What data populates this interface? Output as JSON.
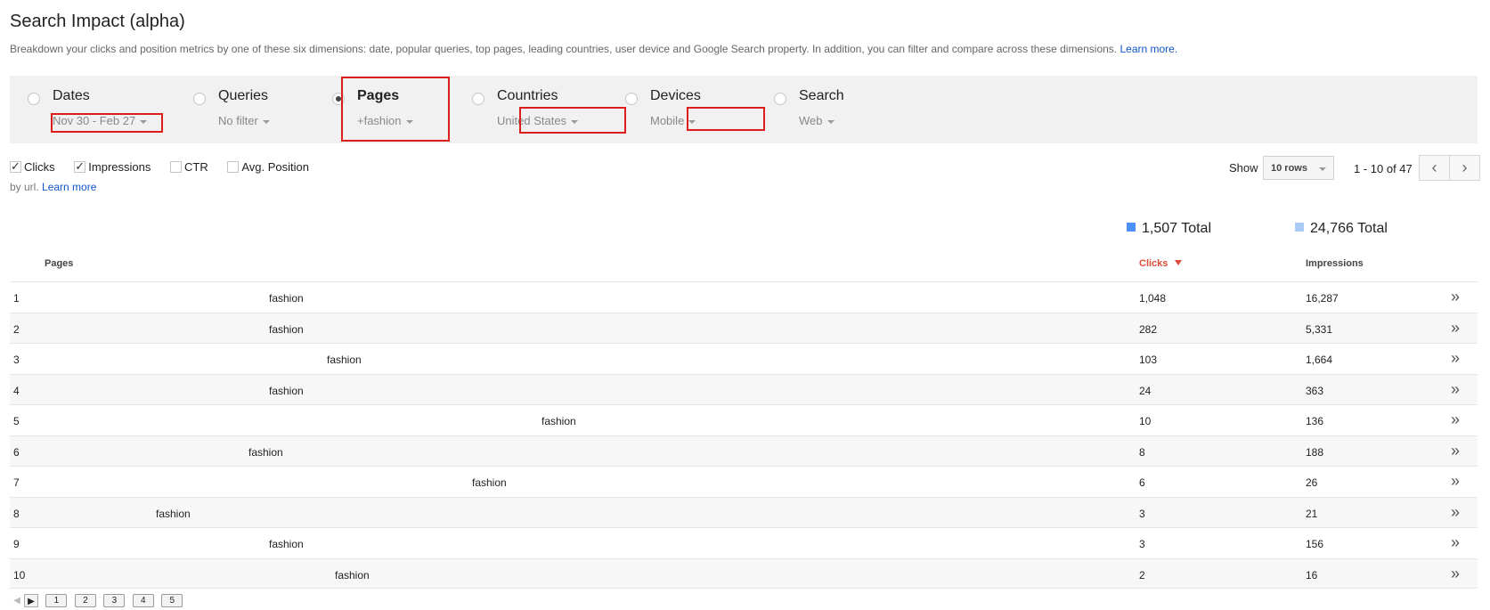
{
  "header": {
    "title": "Search Impact (alpha)",
    "description": "Breakdown your clicks and position metrics by one of these six dimensions: date, popular queries, top pages, leading countries, user device and Google Search property. In addition, you can filter and compare across these dimensions.",
    "learn_more": "Learn more."
  },
  "dimensions": [
    {
      "label": "Dates",
      "filter": "Nov 30 - Feb 27"
    },
    {
      "label": "Queries",
      "filter": "No filter"
    },
    {
      "label": "Pages",
      "filter": "+fashion"
    },
    {
      "label": "Countries",
      "filter": "United States"
    },
    {
      "label": "Devices",
      "filter": "Mobile"
    },
    {
      "label": "Search",
      "filter": "Web"
    }
  ],
  "selected_dimension": "Pages",
  "metrics": [
    {
      "label": "Clicks",
      "checked": true
    },
    {
      "label": "Impressions",
      "checked": true
    },
    {
      "label": "CTR",
      "checked": false
    },
    {
      "label": "Avg. Position",
      "checked": false
    }
  ],
  "grouping_note": "by url.",
  "grouping_learn_more": "Learn more",
  "pagination_controls": {
    "show_label": "Show",
    "rows_value": "10 rows",
    "range_text": "1 - 10 of 47",
    "prev": "‹",
    "next": "›"
  },
  "totals": {
    "clicks_total": "1,507 Total",
    "impressions_total": "24,766 Total"
  },
  "colors": {
    "clicks": "#4d90fe",
    "impressions": "#a9cbf5",
    "highlight": "#dd1c1c",
    "sort": "#dd4b39"
  },
  "table": {
    "columns": {
      "pages": "Pages",
      "clicks": "Clicks",
      "impressions": "Impressions"
    },
    "sort_column": "Clicks",
    "rows": [
      {
        "num": "1",
        "page": "fashion",
        "clicks": "1,048",
        "impressions": "16,287"
      },
      {
        "num": "2",
        "page": "fashion",
        "clicks": "282",
        "impressions": "5,331"
      },
      {
        "num": "3",
        "page": "fashion",
        "clicks": "103",
        "impressions": "1,664"
      },
      {
        "num": "4",
        "page": "fashion",
        "clicks": "24",
        "impressions": "363"
      },
      {
        "num": "5",
        "page": "fashion",
        "clicks": "10",
        "impressions": "136"
      },
      {
        "num": "6",
        "page": "fashion",
        "clicks": "8",
        "impressions": "188"
      },
      {
        "num": "7",
        "page": "fashion",
        "clicks": "6",
        "impressions": "26"
      },
      {
        "num": "8",
        "page": "fashion",
        "clicks": "3",
        "impressions": "21"
      },
      {
        "num": "9",
        "page": "fashion",
        "clicks": "3",
        "impressions": "156"
      },
      {
        "num": "10",
        "page": "fashion",
        "clicks": "2",
        "impressions": "16"
      }
    ],
    "row_action_icon": "»"
  },
  "bottom_pager": {
    "prev": "◀",
    "next": "▶",
    "pages": [
      "1",
      "2",
      "3",
      "4",
      "5"
    ]
  }
}
